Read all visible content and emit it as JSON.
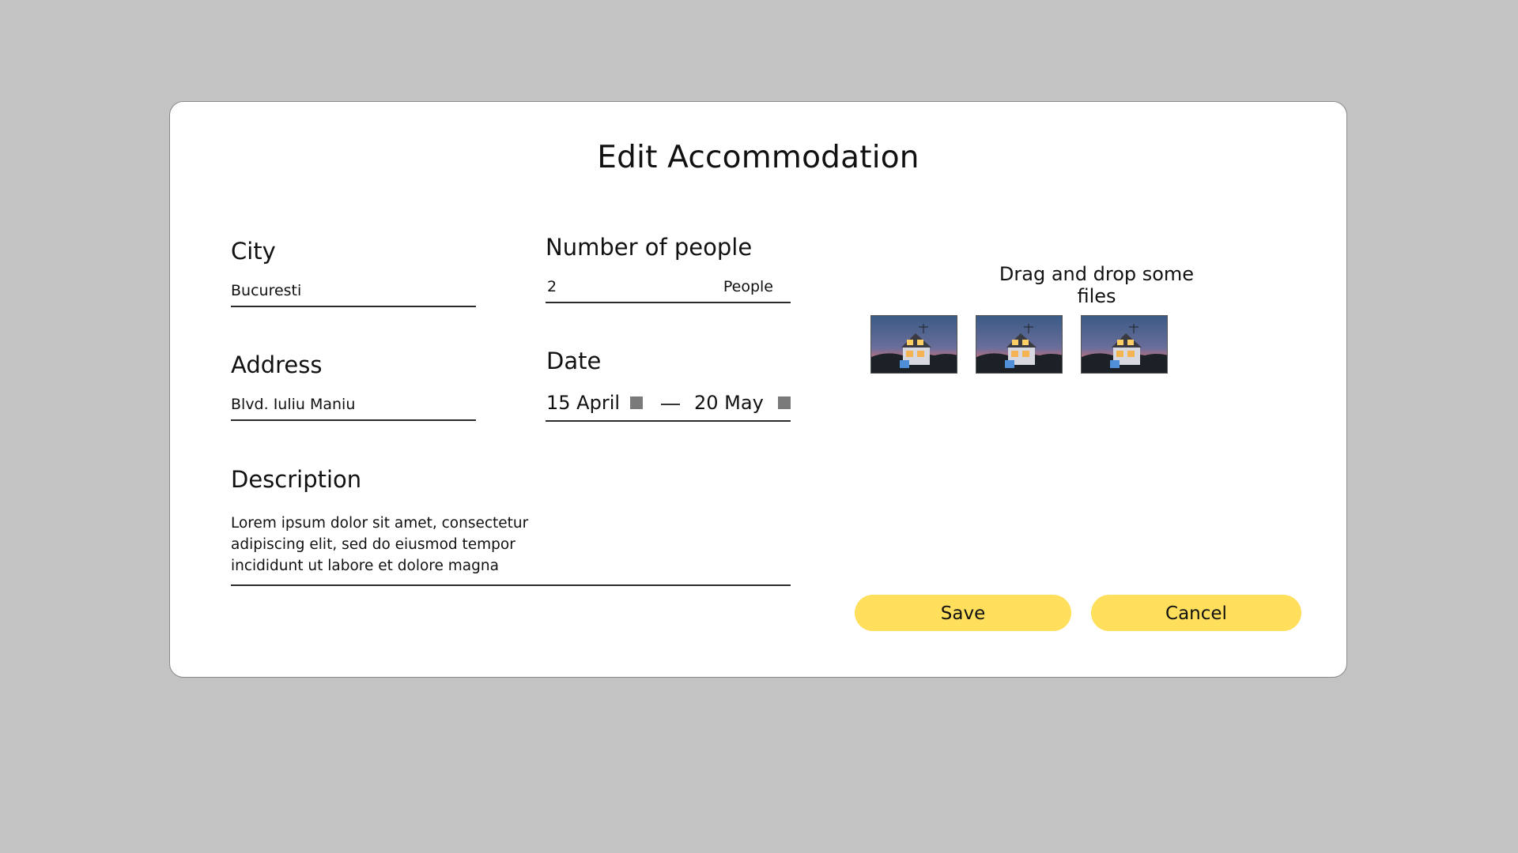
{
  "dialog": {
    "title": "Edit Accommodation"
  },
  "city": {
    "label": "City",
    "value": "Bucuresti"
  },
  "address": {
    "label": "Address",
    "value": "Blvd. Iuliu Maniu"
  },
  "people": {
    "label": "Number of people",
    "value": "2",
    "suffix": "People"
  },
  "date": {
    "label": "Date",
    "start": "15 April",
    "end": "20 May",
    "calendar_icon": "calendar-icon"
  },
  "description": {
    "label": "Description",
    "value": "Lorem ipsum dolor sit amet, consectetur adipiscing elit, sed do eiusmod tempor incididunt ut labore et dolore magna"
  },
  "files": {
    "label": "Drag and drop some files",
    "thumbnails": [
      "house-photo",
      "house-photo",
      "house-photo"
    ]
  },
  "actions": {
    "save_label": "Save",
    "cancel_label": "Cancel",
    "accent_color": "#ffdf5c"
  }
}
